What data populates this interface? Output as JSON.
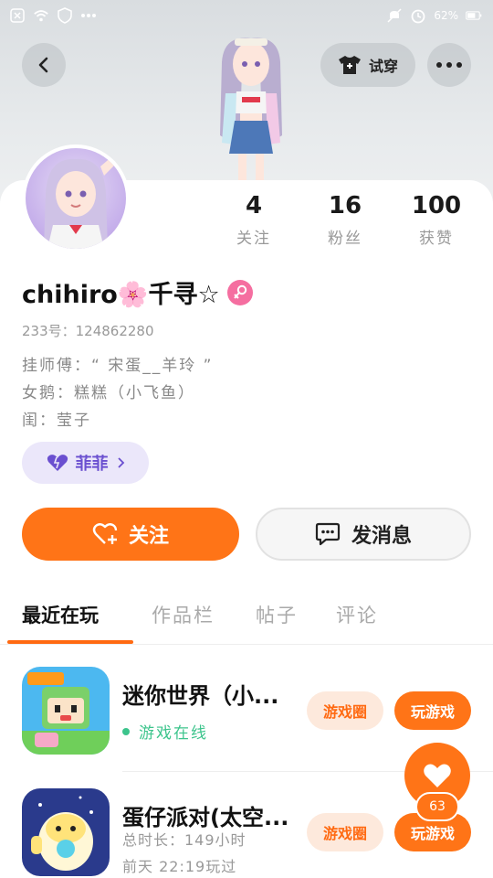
{
  "status_bar": {
    "battery": "62%"
  },
  "header": {
    "try_on_label": "试穿"
  },
  "profile": {
    "name": "chihiro🌸千寻☆",
    "uid": "233号：124862280",
    "bio_lines": [
      "挂师傅：“ 宋蛋__羊玲 ”",
      "女鹅：糕糕（小飞鱼）",
      "闺：莹子"
    ],
    "tag_label": "菲菲"
  },
  "stats": [
    {
      "value": "4",
      "label": "关注"
    },
    {
      "value": "16",
      "label": "粉丝"
    },
    {
      "value": "100",
      "label": "获赞"
    }
  ],
  "actions": {
    "follow_label": "关注",
    "message_label": "发消息"
  },
  "tabs": [
    "最近在玩",
    "作品栏",
    "帖子",
    "评论"
  ],
  "games": [
    {
      "name": "迷你世界（小...",
      "status": "游戏在线",
      "circle_label": "游戏圈",
      "play_label": "玩游戏"
    },
    {
      "name": "蛋仔派对(太空...",
      "duration": "总时长：149小时",
      "last_played": "前天 22:19玩过",
      "circle_label": "游戏圈",
      "play_label": "玩游戏"
    }
  ],
  "like_fab": {
    "count": "63"
  },
  "colors": {
    "accent": "#ff7417",
    "online": "#3cc48c",
    "tag": "#6a4fd0",
    "gender": "#f56ea0"
  }
}
